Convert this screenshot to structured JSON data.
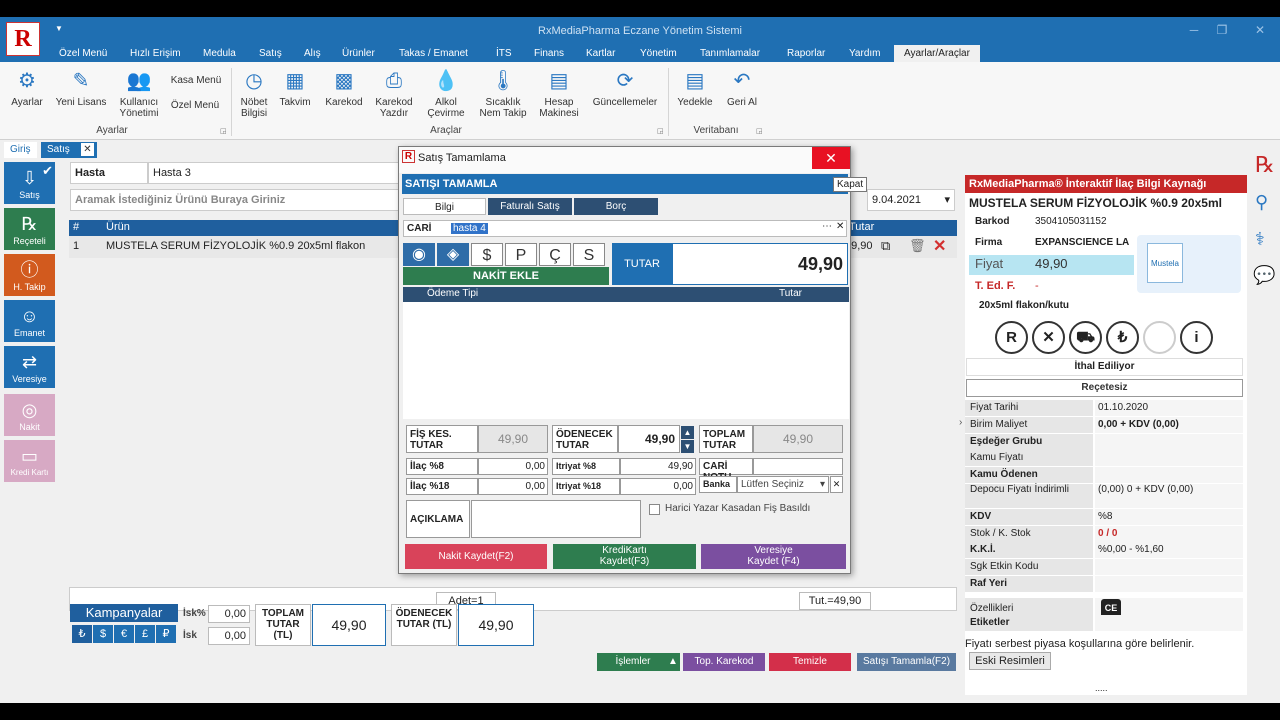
{
  "app": {
    "title": "RxMediaPharma Eczane Yönetim Sistemi"
  },
  "menu": [
    "Özel Menü",
    "Hızlı Erişim",
    "Medula",
    "Satış",
    "Alış",
    "Ürünler",
    "Takas / Emanet",
    "İTS",
    "Finans",
    "Kartlar",
    "Yönetim",
    "Tanımlamalar",
    "Raporlar",
    "Yardım",
    "Ayarlar/Araçlar"
  ],
  "ribbon": {
    "ayarlar": {
      "settings": "Ayarlar",
      "license": "Yeni Lisans",
      "users": "Kullanıcı Yönetimi",
      "kasa": "Kasa Menü",
      "ozel": "Özel Menü",
      "group": "Ayarlar"
    },
    "araclar": {
      "nobet": "Nöbet Bilgisi",
      "takvim": "Takvim",
      "karekod": "Karekod",
      "karekod_yazdir": "Karekod Yazdır",
      "alkol": "Alkol Çevirme",
      "sicaklik": "Sıcaklık Nem Takip",
      "hesap": "Hesap Makinesi",
      "guncelleme": "Güncellemeler",
      "group": "Araçlar"
    },
    "veritabani": {
      "yedekle": "Yedekle",
      "geri": "Geri Al",
      "group": "Veritabanı"
    }
  },
  "tabs": {
    "giris": "Giriş",
    "satis": "Satış"
  },
  "leftbar": [
    "Satış",
    "Reçeteli",
    "H. Takip",
    "Emanet",
    "Veresiye",
    "Nakit",
    "Kredi Kartı"
  ],
  "main": {
    "hasta_label": "Hasta",
    "hasta_value": "Hasta 3",
    "search_placeholder": "Aramak İstediğiniz Ürünü Buraya Giriniz",
    "date": "9.04.2021",
    "col_no": "#",
    "col_urun": "Ürün",
    "col_tutar": "Tutar",
    "row_no": "1",
    "row_urun": "MUSTELA SERUM FİZYOLOJİK %0.9 20x5ml flakon",
    "row_price": "49,90",
    "adet": "Adet=1",
    "tut": "Tut.=49,90"
  },
  "bottom": {
    "kampanya": "Kampanyalar",
    "isk_pct": "İsk%",
    "isk": "İsk",
    "isk_pct_val": "0,00",
    "isk_val": "0,00",
    "toplam_label": "TOPLAM TUTAR (TL)",
    "toplam_val": "49,90",
    "odenecek_label": "ÖDENECEK TUTAR (TL)",
    "odenecek_val": "49,90",
    "currency": [
      "₺",
      "$",
      "€",
      "£",
      "₽"
    ],
    "islemler": "İşlemler",
    "top_karekod": "Top. Karekod",
    "temizle": "Temizle",
    "satis_tamamla": "Satışı Tamamla(F2)"
  },
  "dialog": {
    "title": "Satış Tamamlama",
    "tooltip": "Kapat",
    "header": "SATIŞI TAMAMLA",
    "tab_bilgi": "Bilgi",
    "tab_faturali": "Faturalı Satış",
    "tab_borc": "Borç",
    "cari_label": "CARİ",
    "cari_value": "hasta 4",
    "pay_types": [
      "$",
      "P",
      "Ç",
      "S"
    ],
    "nakit_ekle": "NAKİT EKLE",
    "tutar_label": "TUTAR",
    "tutar_value": "49,90",
    "col_odeme": "Ödeme Tipi",
    "col_tutar": "Tutar",
    "fis_label": "FİŞ KES. TUTAR",
    "fis_val": "49,90",
    "odenecek_label": "ÖDENECEK TUTAR",
    "odenecek_val": "49,90",
    "toplam_label": "TOPLAM TUTAR",
    "toplam_val": "49,90",
    "ilac8": "İlaç %8",
    "ilac8_val": "0,00",
    "ilac18": "İlaç %18",
    "ilac18_val": "0,00",
    "itriyat8": "Itriyat %8",
    "itriyat8_val": "49,90",
    "itriyat18": "Itriyat %18",
    "itriyat18_val": "0,00",
    "cari_notu": "CARİ NOTU",
    "banka": "Banka",
    "banka_select": "Lütfen Seçiniz",
    "aciklama": "AÇIKLAMA",
    "harici": "Harici Yazar Kasadan Fiş Basıldı",
    "btn_nakit": "Nakit Kaydet(F2)",
    "btn_kredi": "KrediKartı Kaydet(F3)",
    "btn_veresiye": "Veresiye Kaydet (F4)"
  },
  "rpanel": {
    "title": "RxMediaPharma® İnteraktif İlaç Bilgi Kaynağı",
    "product": "MUSTELA SERUM FİZYOLOJİK %0.9 20x5ml",
    "barkod_label": "Barkod",
    "barkod": "3504105031152",
    "firma_label": "Firma",
    "firma": "EXPANSCIENCE LA",
    "fiyat_label": "Fiyat",
    "fiyat": "49,90",
    "ted_label": "T. Ed. F.",
    "ted": "-",
    "pack": "20x5ml flakon/kutu",
    "brand_box": "Mustela",
    "ithal": "İthal Ediliyor",
    "recete": "Reçetesiz",
    "props": [
      {
        "k": "Fiyat Tarihi",
        "v": "01.10.2020"
      },
      {
        "k": "Birim Maliyet",
        "v": "0,00 + KDV (0,00)"
      },
      {
        "k": "Eşdeğer Grubu",
        "v": ""
      },
      {
        "k": "Kamu Fiyatı",
        "v": ""
      },
      {
        "k": "Kamu Ödenen",
        "v": ""
      },
      {
        "k": "Depocu Fiyatı İndirimli",
        "v": "(0,00)  0 + KDV (0,00)"
      },
      {
        "k": "KDV",
        "v": "%8"
      },
      {
        "k": "Stok / K. Stok",
        "v": "0 / 0"
      },
      {
        "k": "K.K.İ.",
        "v": "%0,00 - %1,60"
      },
      {
        "k": "Sgk Etkin Kodu",
        "v": ""
      },
      {
        "k": "Raf Yeri",
        "v": ""
      },
      {
        "k": "Özellikleri",
        "v": ""
      },
      {
        "k": "Etiketler",
        "v": ""
      }
    ],
    "note": "Fiyatı serbest piyasa koşullarına göre belirlenir.",
    "eski": "Eski Resimleri",
    "dots": "....."
  },
  "colors": {
    "blue": "#1f6fb2",
    "red": "#c62828",
    "green": "#2e7d4f",
    "purple": "#7b4fa0"
  }
}
